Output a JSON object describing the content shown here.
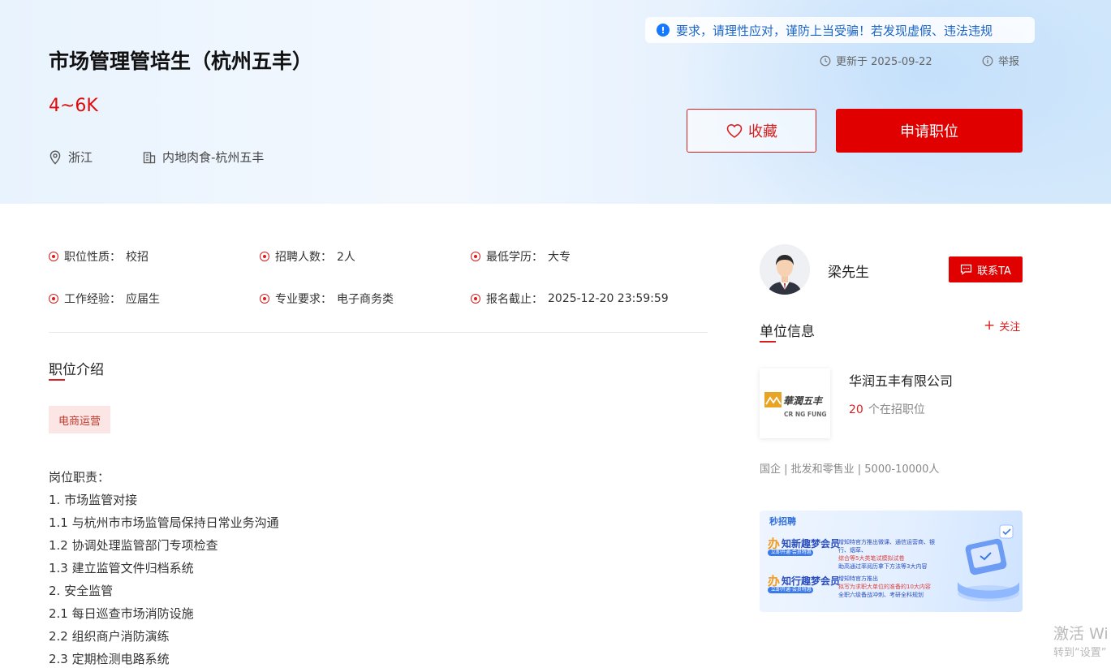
{
  "header": {
    "job_title": "市场管理管培生（杭州五丰）",
    "salary": "4~6K",
    "location": "浙江",
    "organization": "内地肉食-杭州五丰",
    "notice_text": "要求，请理性应对，谨防上当受骗！若发现虚假、违法违规",
    "updated": "更新于 2025-09-22",
    "report": "举报",
    "favorite_label": "收藏",
    "apply_label": "申请职位"
  },
  "attributes": [
    {
      "key": "职位性质：",
      "value": "校招"
    },
    {
      "key": "招聘人数：",
      "value": "2人"
    },
    {
      "key": "最低学历：",
      "value": "大专"
    },
    {
      "key": "工作经验：",
      "value": "应届生"
    },
    {
      "key": "专业要求：",
      "value": "电子商务类"
    },
    {
      "key": "报名截止：",
      "value": "2025-12-20 23:59:59"
    }
  ],
  "intro": {
    "title": "职位介绍",
    "tag": "电商运营",
    "lines": [
      "岗位职责：",
      "1. 市场监管对接",
      "1.1 与杭州市市场监管局保持日常业务沟通",
      "1.2 协调处理监管部门专项检查",
      "1.3 建立监管文件归档系统",
      "2. 安全监管",
      "2.1 每日巡查市场消防设施",
      "2.2 组织商户消防演练",
      "2.3 定期检测电路系统"
    ]
  },
  "sidebar": {
    "recruiter_name": "梁先生",
    "contact_label": "联系TA",
    "unit_title": "单位信息",
    "follow_label": "关注",
    "company_name": "华润五丰有限公司",
    "jobs_count": "20",
    "jobs_suffix": "个在招职位",
    "company_meta": "国企 | 批发和零售业 | 5000-10000人",
    "logo_cn": "華潤五丰",
    "logo_en": "CR NG FUNG"
  },
  "banner": {
    "brand": "秒招聘",
    "item1_title": "知新趣梦会员",
    "item1_sub": "立即开通·会员特惠",
    "item1_text": [
      "增知特官方推出微课、通信运营商、银行、烟草、",
      "综合等5大类笔试模拟试卷",
      "助高通过率阅历拿下方法等3大内容"
    ],
    "item2_title": "知行趣梦会员",
    "item2_sub": "立即开通·会员特惠",
    "item2_text": [
      "增知特官方推出",
      "拟写为求职大单位的准备的10大内容",
      "全职六级备战冲刺、考研全科规划"
    ],
    "ban_glyph": "办"
  },
  "watermark": {
    "line1": "激活 Wi",
    "line2": "转到“设置”"
  },
  "colors": {
    "accent": "#e00000",
    "notice": "#1677ff"
  }
}
